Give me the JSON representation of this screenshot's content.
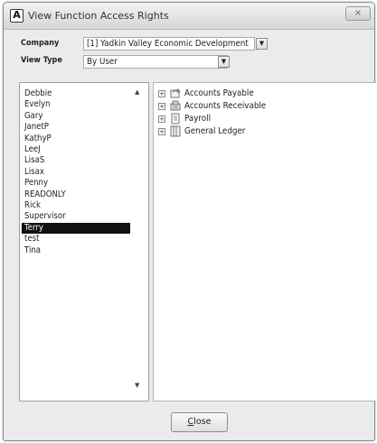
{
  "window": {
    "title": "View Function Access Rights",
    "app_icon_letter": "A",
    "close_glyph": "×"
  },
  "filters": {
    "company_label": "Company",
    "company_value": "[1]   Yadkin Valley Economic Development",
    "view_type_label": "View Type",
    "view_type_value": "By User"
  },
  "users": {
    "items": [
      "Debbie",
      "Evelyn",
      "Gary",
      "JanetP",
      "KathyP",
      "LeeJ",
      "LisaS",
      "Lisax",
      "Penny",
      "READONLY",
      "Rick",
      "Supervisor",
      "Terry",
      "test",
      "Tina"
    ],
    "selected": "Terry"
  },
  "functions": {
    "items": [
      {
        "label": "Accounts Payable",
        "icon": "accounts-payable-icon",
        "expander": "+"
      },
      {
        "label": "Accounts Receivable",
        "icon": "accounts-receivable-icon",
        "expander": "+"
      },
      {
        "label": "Payroll",
        "icon": "payroll-icon",
        "expander": "+"
      },
      {
        "label": "General Ledger",
        "icon": "general-ledger-icon",
        "expander": "+"
      }
    ]
  },
  "buttons": {
    "close_label_mnemonic": "C",
    "close_label_rest": "lose"
  },
  "colors": {
    "selection_bg": "#111111",
    "window_bg": "#ebebeb"
  }
}
